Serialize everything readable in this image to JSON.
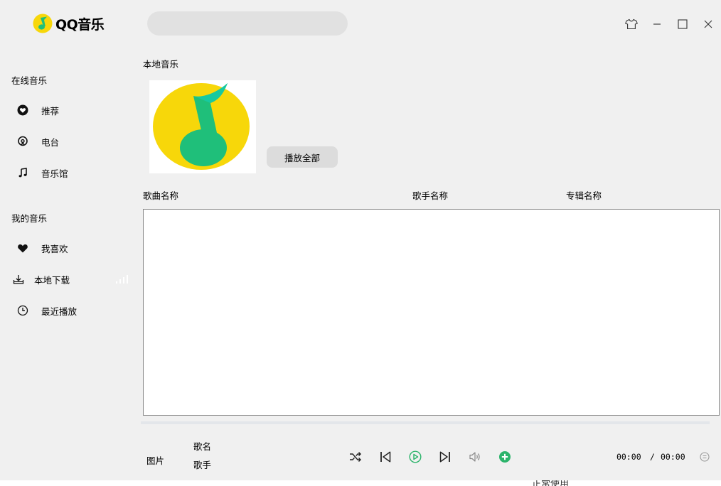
{
  "app": {
    "brand": "QQ音乐",
    "colors": {
      "logo_yellow": "#f7d70a",
      "logo_green": "#1fbf7a",
      "accent_green": "#2cb46b"
    }
  },
  "sidebar": {
    "online_section": "在线音乐",
    "online_items": [
      {
        "label": "推荐",
        "icon": "heart-badge-icon"
      },
      {
        "label": "电台",
        "icon": "radio-icon"
      },
      {
        "label": "音乐馆",
        "icon": "music-note-icon"
      }
    ],
    "my_section": "我的音乐",
    "my_items": [
      {
        "label": "我喜欢",
        "icon": "heart-icon"
      },
      {
        "label": "本地下载",
        "icon": "download-icon"
      },
      {
        "label": "最近播放",
        "icon": "clock-icon"
      }
    ]
  },
  "header": {
    "search_placeholder": "",
    "window_buttons": [
      "skin-icon",
      "minimize-icon",
      "maximize-icon",
      "close-icon"
    ]
  },
  "main": {
    "title": "本地音乐",
    "play_all_label": "播放全部",
    "columns": [
      "歌曲名称",
      "歌手名称",
      "专辑名称"
    ],
    "rows": []
  },
  "player": {
    "cover_label": "图片",
    "song_name": "歌名",
    "artist": "歌手",
    "current_time": "00:00",
    "separator": "/",
    "total_time": "00:00",
    "progress": 0
  },
  "footer_fragment": "正常使用"
}
